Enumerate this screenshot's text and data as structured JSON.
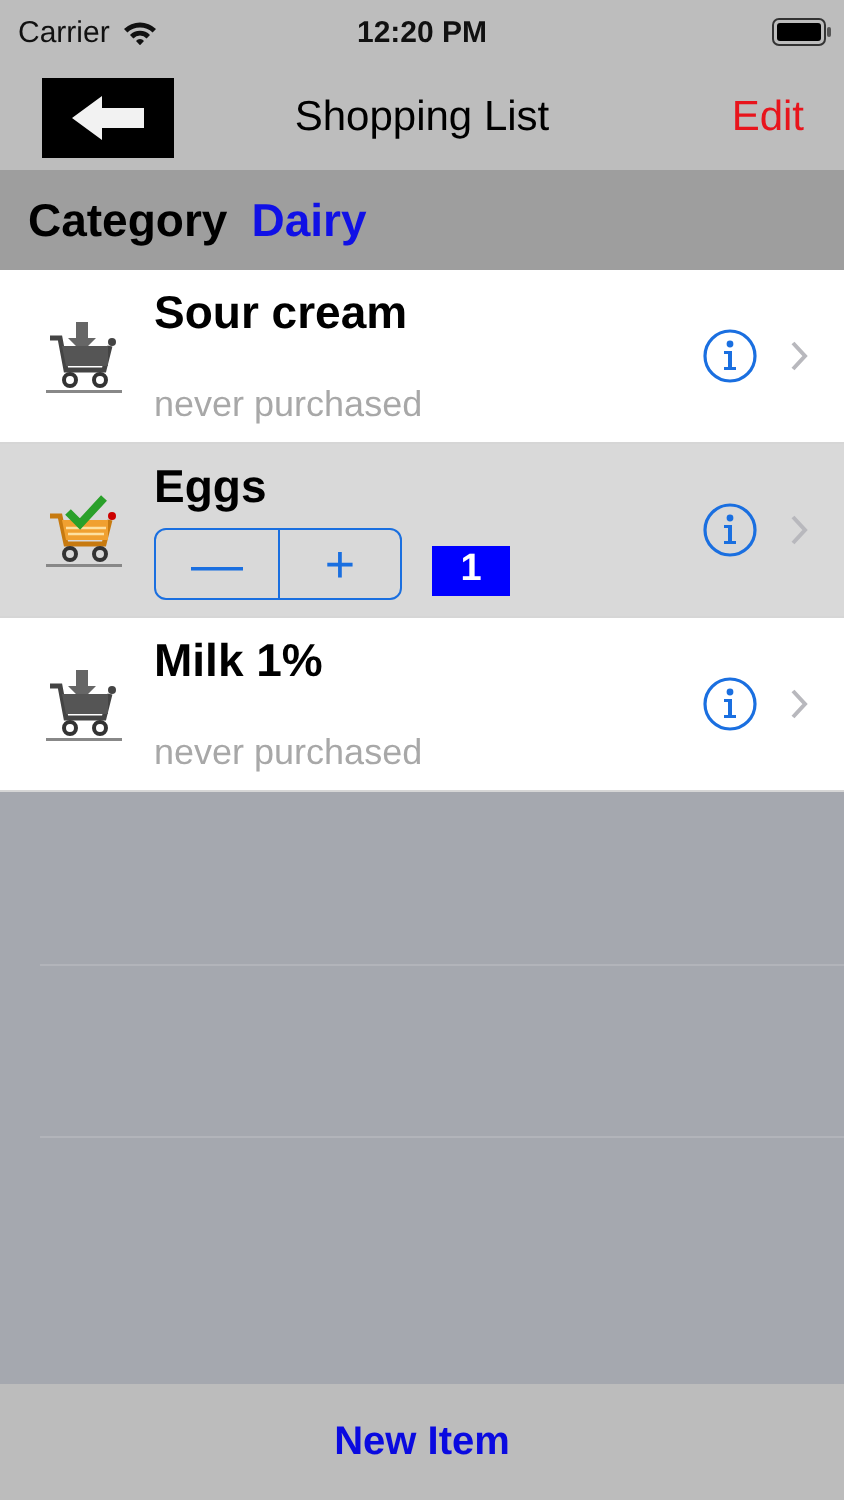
{
  "status_bar": {
    "carrier": "Carrier",
    "time": "12:20 PM"
  },
  "nav": {
    "title": "Shopping List",
    "edit": "Edit"
  },
  "category": {
    "label": "Category",
    "value": "Dairy"
  },
  "items": [
    {
      "kind": "pending",
      "name": "Sour cream",
      "subtitle": "never purchased",
      "selected": false
    },
    {
      "kind": "purchased",
      "name": "Eggs",
      "minus": "—",
      "plus": "+",
      "quantity": "1",
      "selected": true
    },
    {
      "kind": "pending",
      "name": "Milk 1%",
      "subtitle": "never purchased",
      "selected": false
    }
  ],
  "bottom_bar": {
    "button": "New Item"
  }
}
